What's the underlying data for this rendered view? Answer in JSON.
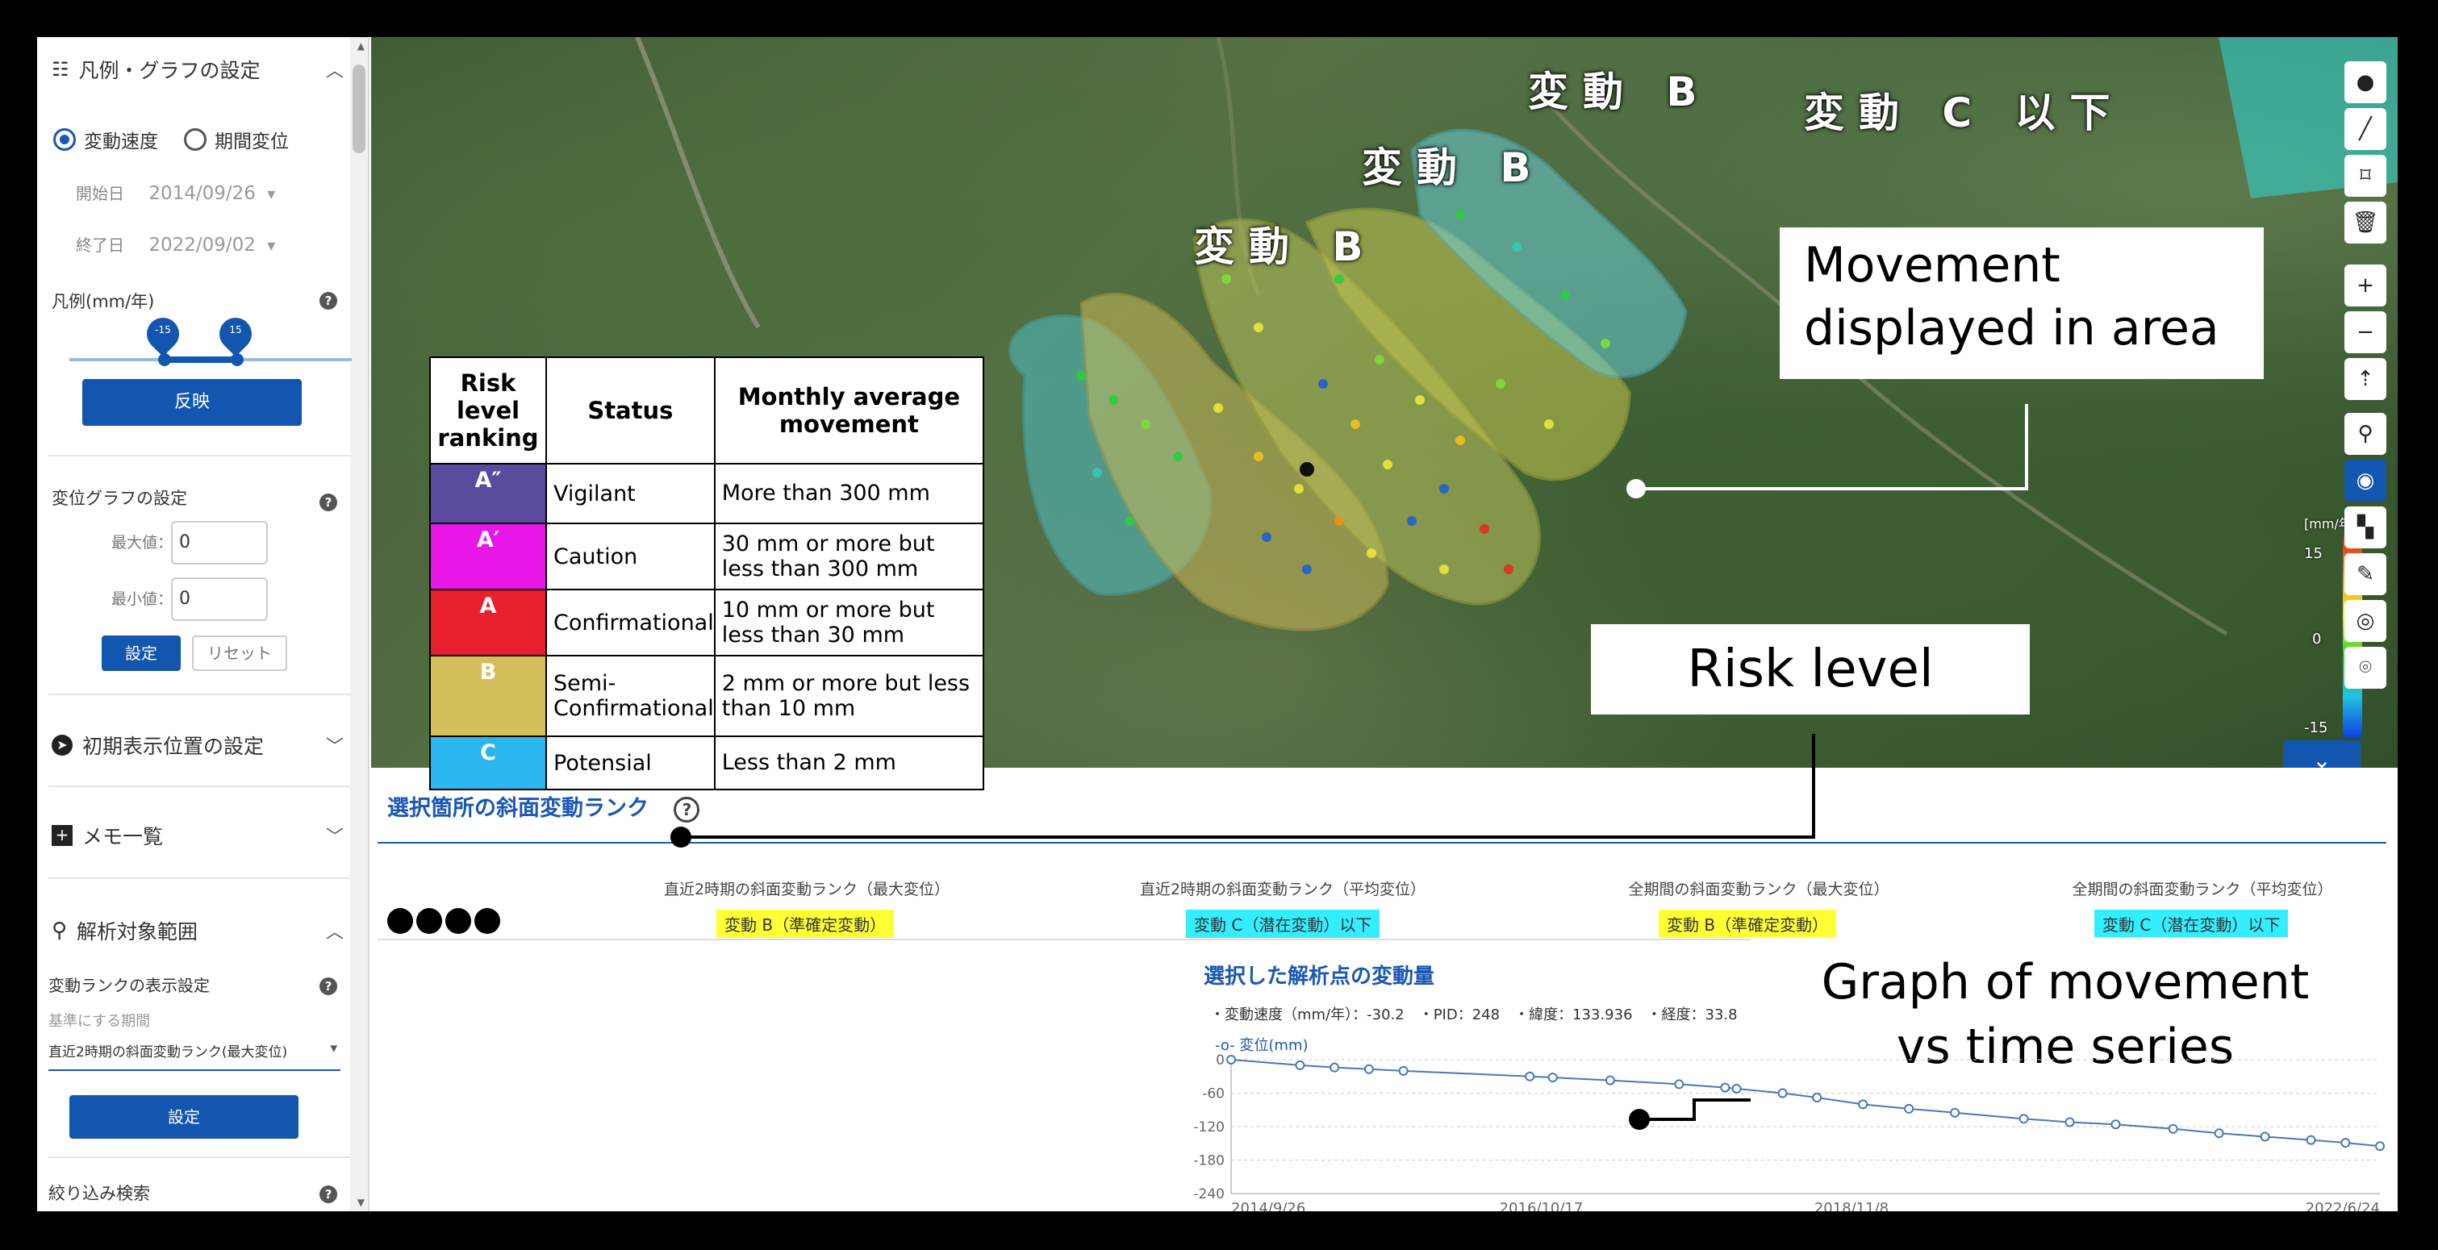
{
  "sidebar": {
    "legend_section_title": "凡例・グラフの設定",
    "radio_velocity": "変動速度",
    "radio_period": "期間変位",
    "start_label": "開始日",
    "start_value": "2014/09/26",
    "end_label": "終了日",
    "end_value": "2022/09/02",
    "legend_label": "凡例(mm/年)",
    "slider_min": "-15",
    "slider_max": "15",
    "apply_button": "反映",
    "graph_settings_label": "変位グラフの設定",
    "max_label": "最大値：",
    "max_value": "0",
    "min_label": "最小値：",
    "min_value": "0",
    "set_button": "設定",
    "reset_button": "リセット",
    "initial_position_title": "初期表示位置の設定",
    "memo_title": "メモ一覧",
    "analysis_range_title": "解析対象範囲",
    "rank_display_label": "変動ランクの表示設定",
    "base_period_label": "基準にする期間",
    "base_period_value": "直近2時期の斜面変動ランク(最大変位)",
    "set_button_2": "設定",
    "filter_search_label": "絞り込み検索"
  },
  "map": {
    "labels": [
      "変動 B",
      "変動 B",
      "変動 B",
      "変動 C 以下"
    ],
    "callout_area": "Movement displayed in area",
    "callout_risk": "Risk level",
    "callout_graph_line1": "Graph of movement",
    "callout_graph_line2": "vs time series",
    "scale_unit": "[mm/年]",
    "scale_max": "15",
    "scale_mid": "0",
    "scale_min": "-15"
  },
  "risk_table": {
    "headers": [
      "Risk level ranking",
      "Status",
      "Monthly average movement"
    ],
    "rows": [
      {
        "code": "A″",
        "status": "Vigilant",
        "movement": "More than 300 mm",
        "color": "#5b4a9e"
      },
      {
        "code": "A′",
        "status": "Caution",
        "movement": "30 mm or more but less than 300 mm",
        "color": "#e817e8"
      },
      {
        "code": "A",
        "status": "Confirmational",
        "movement": "10 mm or more but less than 30 mm",
        "color": "#e8202e"
      },
      {
        "code": "B",
        "status": "Semi-Confirmational",
        "movement": "2 mm or more but less than 10 mm",
        "color": "#d4bf5c"
      },
      {
        "code": "C",
        "status": "Potensial",
        "movement": "Less than 2 mm",
        "color": "#2bb6f0"
      }
    ]
  },
  "bottom": {
    "title": "選択箇所の斜面変動ランク",
    "headers": [
      "直近2時期の斜面変動ランク（最大変位）",
      "直近2時期の斜面変動ランク（平均変位）",
      "全期間の斜面変動ランク（最大変位）",
      "全期間の斜面変動ランク（平均変位）"
    ],
    "values": [
      {
        "text": "変動 B（準確定変動）",
        "color": "#ffff33"
      },
      {
        "text": "変動 C（潜在変動）以下",
        "color": "#33eeff"
      },
      {
        "text": "変動 B（準確定変動）",
        "color": "#ffff33"
      },
      {
        "text": "変動 C（潜在変動）以下",
        "color": "#33eeff"
      }
    ],
    "graph_title": "選択した解析点の変動量",
    "graph_info": "・変動速度（mm/年）：-30.2　・PID：248　・緯度：133.936　・経度：33.8",
    "graph_legend": "-o- 変位(mm)"
  },
  "chart_data": {
    "type": "line",
    "title": "選択した解析点の変動量",
    "ylabel": "変位(mm)",
    "ylim": [
      -240,
      0
    ],
    "yticks": [
      0,
      -60,
      -120,
      -180,
      -240
    ],
    "xticks": [
      "2014/9/26",
      "2016/10/17",
      "2018/11/8",
      "2022/6/24"
    ],
    "series": [
      {
        "name": "変位(mm)",
        "x": [
          0,
          0.06,
          0.09,
          0.12,
          0.15,
          0.26,
          0.28,
          0.33,
          0.39,
          0.43,
          0.44,
          0.48,
          0.51,
          0.55,
          0.59,
          0.63,
          0.69,
          0.73,
          0.77,
          0.82,
          0.86,
          0.9,
          0.94,
          0.97,
          1.0
        ],
        "values": [
          0,
          -10,
          -14,
          -17,
          -20,
          -30,
          -32,
          -37,
          -44,
          -50,
          -52,
          -60,
          -68,
          -80,
          -88,
          -95,
          -106,
          -112,
          -116,
          -124,
          -132,
          -138,
          -144,
          -149,
          -155
        ]
      }
    ]
  }
}
